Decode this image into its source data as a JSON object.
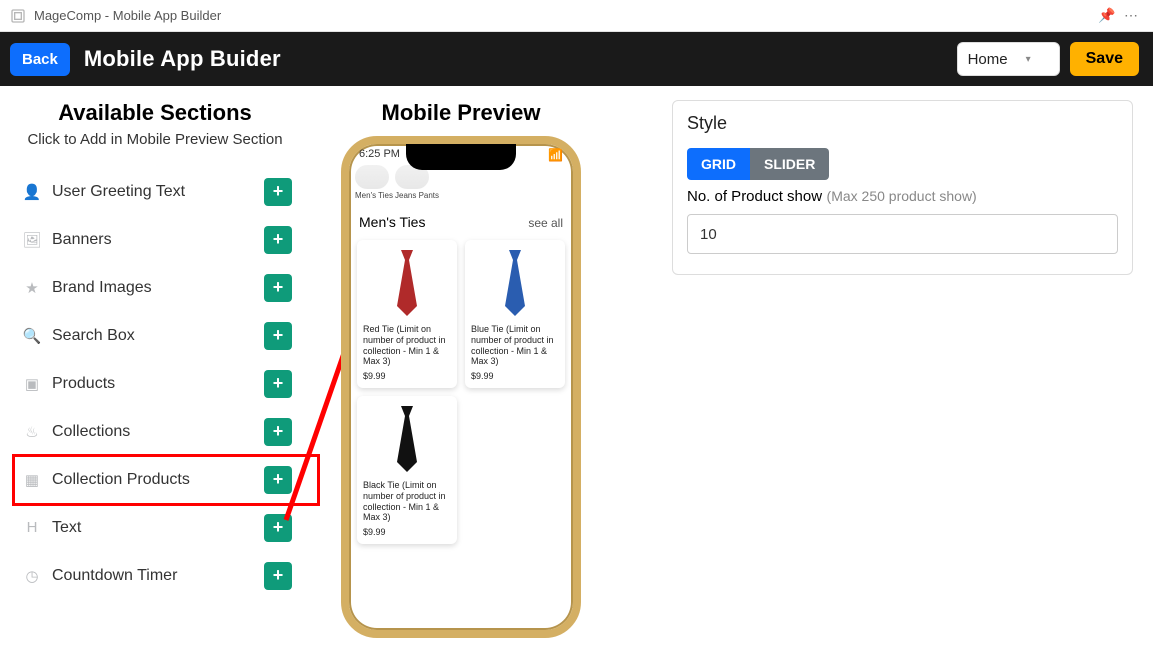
{
  "appbar": {
    "title": "MageComp - Mobile App Builder"
  },
  "header": {
    "back_label": "Back",
    "title": "Mobile App Buider",
    "home_label": "Home",
    "save_label": "Save"
  },
  "sidebar": {
    "heading": "Available Sections",
    "subheading": "Click to Add in Mobile Preview Section",
    "items": [
      {
        "label": "User Greeting Text"
      },
      {
        "label": "Banners"
      },
      {
        "label": "Brand Images"
      },
      {
        "label": "Search Box"
      },
      {
        "label": "Products"
      },
      {
        "label": "Collections"
      },
      {
        "label": "Collection Products"
      },
      {
        "label": "Text"
      },
      {
        "label": "Countdown Timer"
      }
    ]
  },
  "preview": {
    "heading": "Mobile Preview",
    "time": "6:25 PM",
    "tabs": [
      {
        "label": "Men's Ties"
      },
      {
        "label": "Jeans Pants"
      }
    ],
    "section_title": "Men's Ties",
    "see_all": "see all",
    "products": [
      {
        "name": "Red Tie (Limit on number of product in collection - Min 1 & Max 3)",
        "price": "$9.99",
        "color": "#b02a2a"
      },
      {
        "name": "Blue Tie (Limit on number of product in collection - Min 1 & Max 3)",
        "price": "$9.99",
        "color": "#2a5db0"
      },
      {
        "name": "Black Tie (Limit on number of product in collection - Min 1 & Max 3)",
        "price": "$9.99",
        "color": "#111111"
      }
    ]
  },
  "style_panel": {
    "title": "Style",
    "grid_label": "GRID",
    "slider_label": "SLIDER",
    "field_label": "No. of Product show",
    "field_hint": "(Max 250 product show)",
    "field_value": "10"
  }
}
